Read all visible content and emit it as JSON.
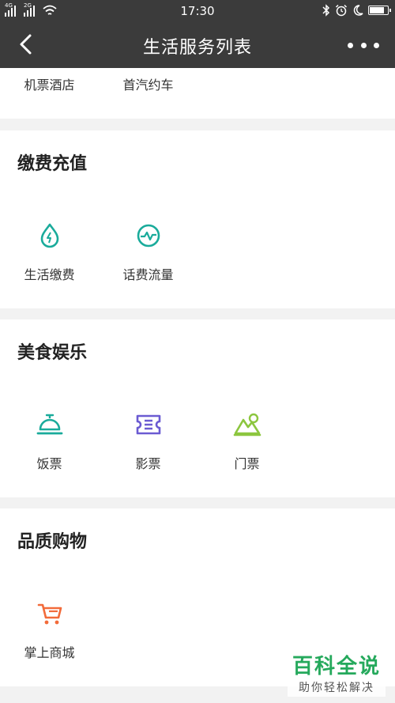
{
  "status_bar": {
    "signal_1_label": "4G",
    "signal_2_label": "2G",
    "time": "17:30",
    "battery_level": 0.85
  },
  "nav": {
    "title": "生活服务列表"
  },
  "top_row": {
    "items": [
      {
        "label": "机票酒店"
      },
      {
        "label": "首汽约车"
      }
    ]
  },
  "sections": [
    {
      "title": "缴费充值",
      "items": [
        {
          "label": "生活缴费",
          "icon": "water-drop-bolt-icon",
          "color": "#1aab9b"
        },
        {
          "label": "话费流量",
          "icon": "pulse-circle-icon",
          "color": "#1aab9b"
        }
      ]
    },
    {
      "title": "美食娱乐",
      "items": [
        {
          "label": "饭票",
          "icon": "food-cloche-icon",
          "color": "#1aab9b"
        },
        {
          "label": "影票",
          "icon": "ticket-icon",
          "color": "#6b5bd2"
        },
        {
          "label": "门票",
          "icon": "mountain-ticket-icon",
          "color": "#8cc63f"
        }
      ]
    },
    {
      "title": "品质购物",
      "items": [
        {
          "label": "掌上商城",
          "icon": "shopping-cart-icon",
          "color": "#f26b3a"
        }
      ]
    }
  ],
  "watermark": {
    "title": "百科全说",
    "subtitle": "助你轻松解决"
  }
}
